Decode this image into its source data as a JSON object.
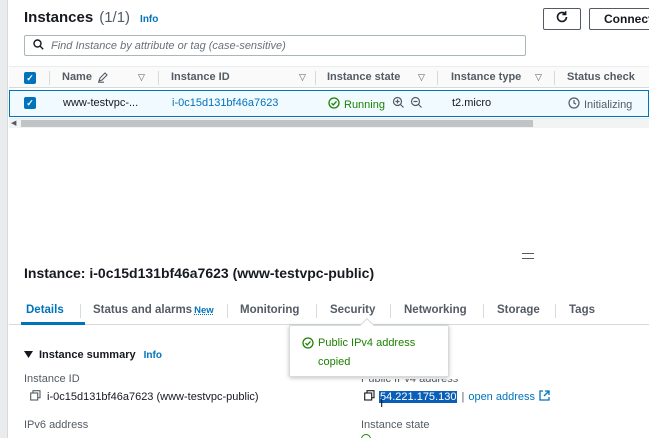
{
  "instances_panel": {
    "title": "Instances",
    "count": "(1/1)",
    "info": "Info",
    "connect_label": "Connect"
  },
  "search": {
    "placeholder": "Find Instance by attribute or tag (case-sensitive)"
  },
  "table": {
    "columns": {
      "name": "Name",
      "instance_id": "Instance ID",
      "instance_state": "Instance state",
      "instance_type": "Instance type",
      "status_check": "Status check"
    },
    "rows": [
      {
        "name": "www-testvpc-...",
        "instance_id": "i-0c15d131bf46a7623",
        "state": "Running",
        "type": "t2.micro",
        "status": "Initializing"
      }
    ]
  },
  "details": {
    "title": "Instance: i-0c15d131bf46a7623 (www-testvpc-public)",
    "tabs": {
      "details": "Details",
      "status_alarms": "Status and alarms",
      "new_badge": "New",
      "monitoring": "Monitoring",
      "security": "Security",
      "networking": "Networking",
      "storage": "Storage",
      "tags": "Tags"
    },
    "summary": {
      "title": "Instance summary",
      "info": "Info",
      "instance_id_label": "Instance ID",
      "instance_id_value": "i-0c15d131bf46a7623 (www-testvpc-public)",
      "ipv6_label": "IPv6 address",
      "public_ip_label": "Public IPv4 address",
      "public_ip_value": "54.221.175.130",
      "open_address": "open address",
      "instance_state_label": "Instance state"
    }
  },
  "toast": {
    "message": "Public IPv4 address copied"
  },
  "colors": {
    "accent": "#0073bb",
    "success": "#1d8102",
    "selection": "#0a5eb7"
  }
}
